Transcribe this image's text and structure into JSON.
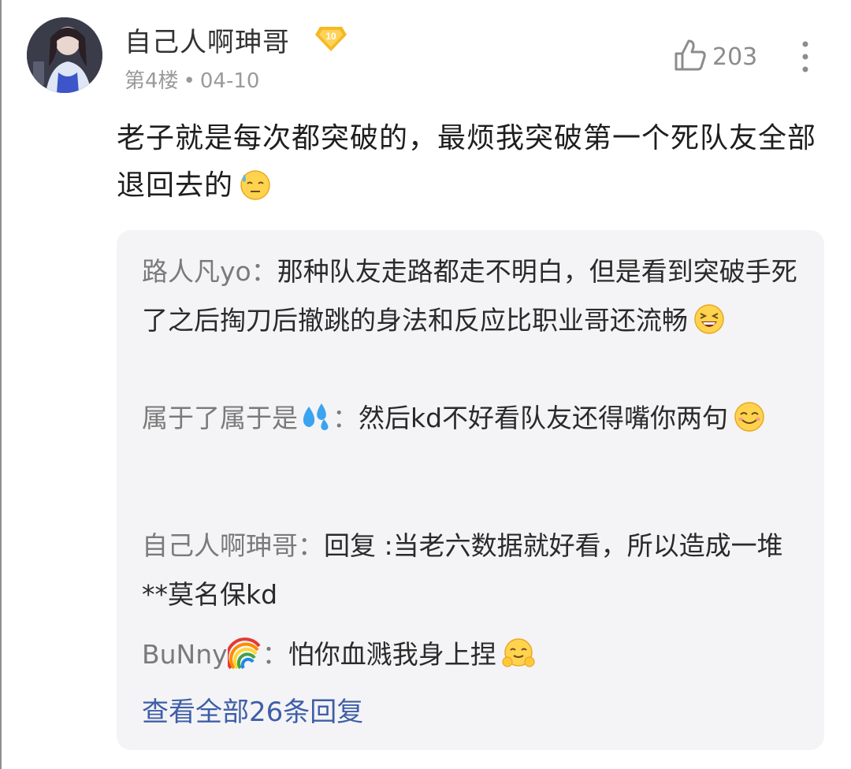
{
  "comment": {
    "username": "自己人啊珅哥",
    "level_badge": "10",
    "floor": "第4楼",
    "separator": "•",
    "date": "04-10",
    "like_count": "203",
    "content": "老子就是每次都突破的，最烦我突破第一个死队友全部退回去的"
  },
  "replies": {
    "items": [
      {
        "name": "路人凡yo：",
        "text": "那种队友走路都走不明白，但是看到突破手死了之后掏刀后撤跳的身法和反应比职业哥还流畅"
      },
      {
        "name": "属于了属于是",
        "name_suffix": "：",
        "text": "然后kd不好看队友还得嘴你两句"
      },
      {
        "name": "自己人啊珅哥：",
        "text": "回复 :当老六数据就好看，所以造成一堆**莫名保kd"
      },
      {
        "name": "BuNny",
        "name_suffix": "：",
        "text": "怕你血溅我身上捏"
      }
    ],
    "view_all": "查看全部26条回复"
  },
  "colors": {
    "link": "#3f5ea8",
    "badge": "#f5b921",
    "reply_bg": "#f4f4f6"
  },
  "icons": [
    "avatar",
    "level-badge-icon",
    "thumbs-up-icon",
    "more-vertical-icon",
    "sweat-emoji-icon",
    "grin-emoji-icon",
    "droplets-emoji-icon",
    "smile-emoji-icon",
    "rainbow-emoji-icon",
    "blush-emoji-icon"
  ]
}
